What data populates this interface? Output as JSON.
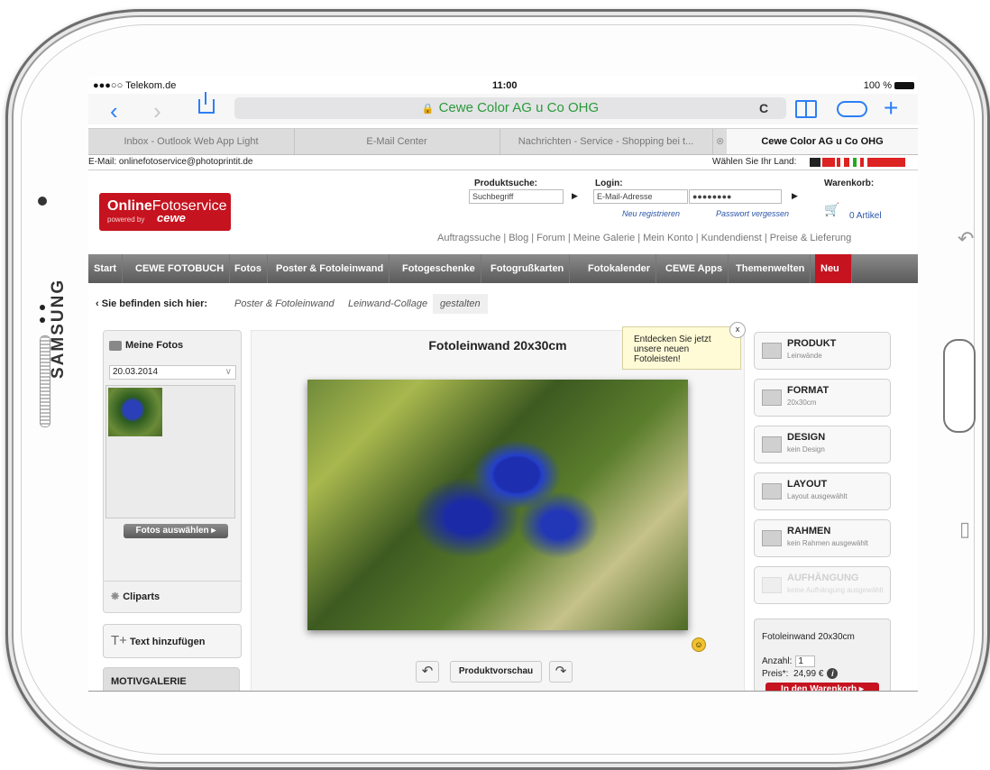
{
  "device": {
    "brand": "SAMSUNG"
  },
  "status_bar": {
    "carrier": "●●●○○ Telekom.de",
    "time": "11:00",
    "battery": "100 %"
  },
  "browser": {
    "address": "Cewe Color AG u Co OHG",
    "tabs": [
      "Inbox - Outlook Web App Light",
      "E-Mail Center",
      "Nachrichten - Service - Shopping bei t...",
      "Cewe Color AG u Co OHG"
    ]
  },
  "page": {
    "email_line": "E-Mail: onlinefotoservice@photoprintit.de",
    "country_label": "Wählen Sie Ihr Land:",
    "logo": {
      "online": "Online",
      "fotoservice": "Fotoservice",
      "powered": "powered by",
      "cewe": "cewe"
    },
    "search": {
      "label": "Produktsuche:",
      "placeholder": "Suchbegriff"
    },
    "login": {
      "label": "Login:",
      "email_placeholder": "E-Mail-Adresse",
      "password_value": "●●●●●●●●",
      "register": "Neu registrieren",
      "forgot": "Passwort vergessen"
    },
    "cart": {
      "label": "Warenkorb:",
      "count": "0 Artikel"
    },
    "sublinks": [
      "Auftragssuche",
      "Blog",
      "Forum",
      "Meine Galerie",
      "Mein Konto",
      "Kundendienst",
      "Preise & Lieferung"
    ],
    "nav": [
      "Start",
      "CEWE FOTOBUCH",
      "Fotos",
      "Poster & Fotoleinwand",
      "Fotogeschenke",
      "Fotogrußkarten",
      "Fotokalender",
      "CEWE Apps",
      "Themenwelten",
      "Neu"
    ],
    "breadcrumb": {
      "label": "Sie befinden sich hier:",
      "items": [
        "Poster & Fotoleinwand",
        "Leinwand-Collage",
        "gestalten"
      ]
    }
  },
  "left_panel": {
    "my_photos": "Meine Fotos",
    "date": "20.03.2014",
    "select_photos": "Fotos auswählen",
    "cliparts": "Cliparts",
    "add_text": "Text hinzufügen",
    "motif_gallery": "MOTIVGALERIE"
  },
  "editor": {
    "title": "Fotoleinwand 20x30cm",
    "tooltip": "Entdecken Sie jetzt unsere neuen Fotoleisten!",
    "tooltip_close": "x",
    "preview_button": "Produktvorschau"
  },
  "options": [
    {
      "title": "PRODUKT",
      "sub": "Leinwände"
    },
    {
      "title": "FORMAT",
      "sub": "20x30cm"
    },
    {
      "title": "DESIGN",
      "sub": "kein Design"
    },
    {
      "title": "LAYOUT",
      "sub": "Layout ausgewählt"
    },
    {
      "title": "RAHMEN",
      "sub": "kein Rahmen ausgewählt"
    },
    {
      "title": "AUFHÄNGUNG",
      "sub": "keine Aufhängung ausgewählt"
    }
  ],
  "order": {
    "product": "Fotoleinwand 20x30cm",
    "qty_label": "Anzahl:",
    "qty": "1",
    "price_label": "Preis*:",
    "price": "24,99 €",
    "cart_button": "In den Warenkorb"
  },
  "colors": {
    "accent_red": "#c5131f",
    "ios_blue": "#2c7ff5",
    "url_green": "#2a9a3a"
  }
}
